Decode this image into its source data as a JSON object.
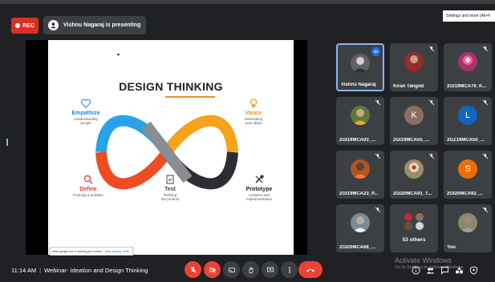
{
  "header": {
    "rec_label": "REC",
    "presenting_text": "Vishnu Nagaraj is presenting",
    "settings_tooltip": "Settings and more (Alt+F"
  },
  "slide": {
    "title": "DESIGN THINKING",
    "stages": [
      {
        "name": "Empathize",
        "desc": "Understanding\npeople",
        "color": "#1e88e5"
      },
      {
        "name": "Ideate",
        "desc": "Generating\nyour ideas",
        "color": "#f39c12"
      },
      {
        "name": "Define",
        "desc": "Framing a problem",
        "color": "#e53935"
      },
      {
        "name": "Test",
        "desc": "Refining\nthe product",
        "color": "#555555"
      },
      {
        "name": "Prototype",
        "desc": "Creation and\nexperimentation",
        "color": "#202124"
      }
    ],
    "share_notice": {
      "text": "meet.google.com is sharing your screen.",
      "stop_label": "Stop sharing",
      "hide_label": "Hide"
    },
    "colors": {
      "blue": "#29a3e8",
      "orange": "#f6a21a",
      "red": "#ef4b24",
      "dark": "#2b2d33",
      "grey": "#8a8d91"
    }
  },
  "participants": [
    {
      "name": "Vishnu Nagaraj",
      "avatar": "photo",
      "color": "#5f6368",
      "active": true
    },
    {
      "name": "Kiran Tangod",
      "avatar": "photo",
      "color": "#8d2f2f"
    },
    {
      "name": "2GI19MCA79_K...",
      "avatar": "photo",
      "color": "#a8326f"
    },
    {
      "name": "2GI19MCA03_...",
      "avatar": "photo",
      "color": "#5b7a3a"
    },
    {
      "name": "2GI19MCA55_...",
      "avatar": "K",
      "color": "#8d6e63"
    },
    {
      "name": "2GZ19MCA50_...",
      "avatar": "L",
      "color": "#1565c0"
    },
    {
      "name": "2GI19MCA23_P...",
      "avatar": "photo",
      "color": "#b0561f"
    },
    {
      "name": "2GI20MCA91_T...",
      "avatar": "photo",
      "color": "#9e8d6a"
    },
    {
      "name": "2GI20MCA92_...",
      "avatar": "S",
      "color": "#ef6c00"
    },
    {
      "name": "2GI20MCA68_...",
      "avatar": "photo",
      "color": "#7b8a9a"
    },
    {
      "name": "53 others",
      "avatar": "multi",
      "color": "#5f6368"
    },
    {
      "name": "You",
      "avatar": "photo",
      "color": "#8a8a6a"
    }
  ],
  "footer": {
    "time": "11:14 AM",
    "meeting_name": "Webinar- Ideation and Design Thinking",
    "watermark_title": "Activate Windows",
    "watermark_sub": "Go to Settings to activate Windows."
  }
}
